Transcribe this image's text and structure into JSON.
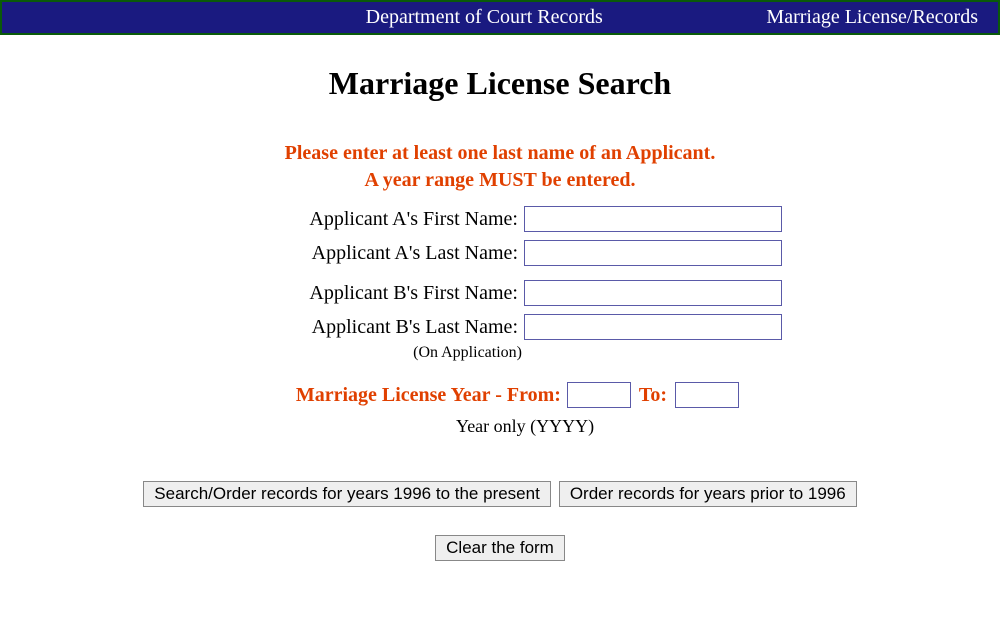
{
  "header": {
    "department": "Department of Court Records",
    "section": "Marriage License/Records"
  },
  "title": "Marriage License Search",
  "instructions": {
    "line1": "Please enter at least one last name of an Applicant.",
    "line2": "A year range MUST be entered."
  },
  "form": {
    "applicant_a_first_label": "Applicant A's First Name:",
    "applicant_a_first_value": "",
    "applicant_a_last_label": "Applicant A's Last Name:",
    "applicant_a_last_value": "",
    "applicant_b_first_label": "Applicant B's First Name:",
    "applicant_b_first_value": "",
    "applicant_b_last_label": "Applicant B's Last Name:",
    "applicant_b_last_value": "",
    "on_application_note": "(On Application)",
    "year_from_label": "Marriage License Year - From:",
    "year_from_value": "",
    "year_to_label": "To:",
    "year_to_value": "",
    "year_hint": "Year only (YYYY)"
  },
  "buttons": {
    "search_recent": "Search/Order records for years 1996 to the present",
    "order_prior": "Order records for years prior to 1996",
    "clear": "Clear the form"
  }
}
